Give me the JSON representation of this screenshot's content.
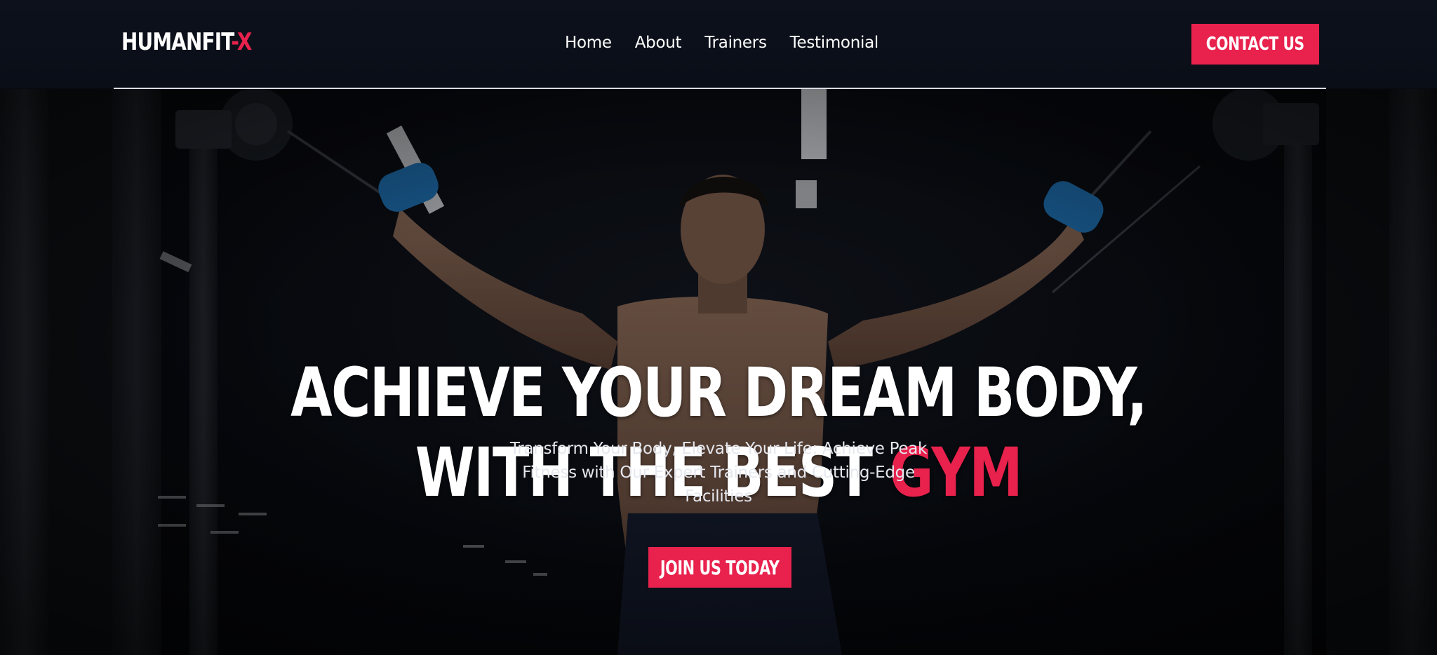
{
  "header": {
    "logo_main": "HUMANFIT",
    "logo_accent": "-X",
    "nav": [
      "Home",
      "About",
      "Trainers",
      "Testimonial"
    ],
    "contact_label": "CONTACT US"
  },
  "hero": {
    "title_line1": "ACHIEVE YOUR DREAM BODY,",
    "title_line2_prefix": "WITH THE BEST ",
    "title_line2_accent": "GYM",
    "subtitle": "Transform Your Body, Elevate Your Life: Achieve Peak Fitness with Our Expert Trainers and Cutting-Edge Facilities",
    "cta_label": "JOIN US TODAY",
    "background": "gym-man-cable-machine-photo"
  },
  "colors": {
    "accent": "#e8214d",
    "header_bg": "#0b0f18",
    "text": "#ffffff"
  }
}
